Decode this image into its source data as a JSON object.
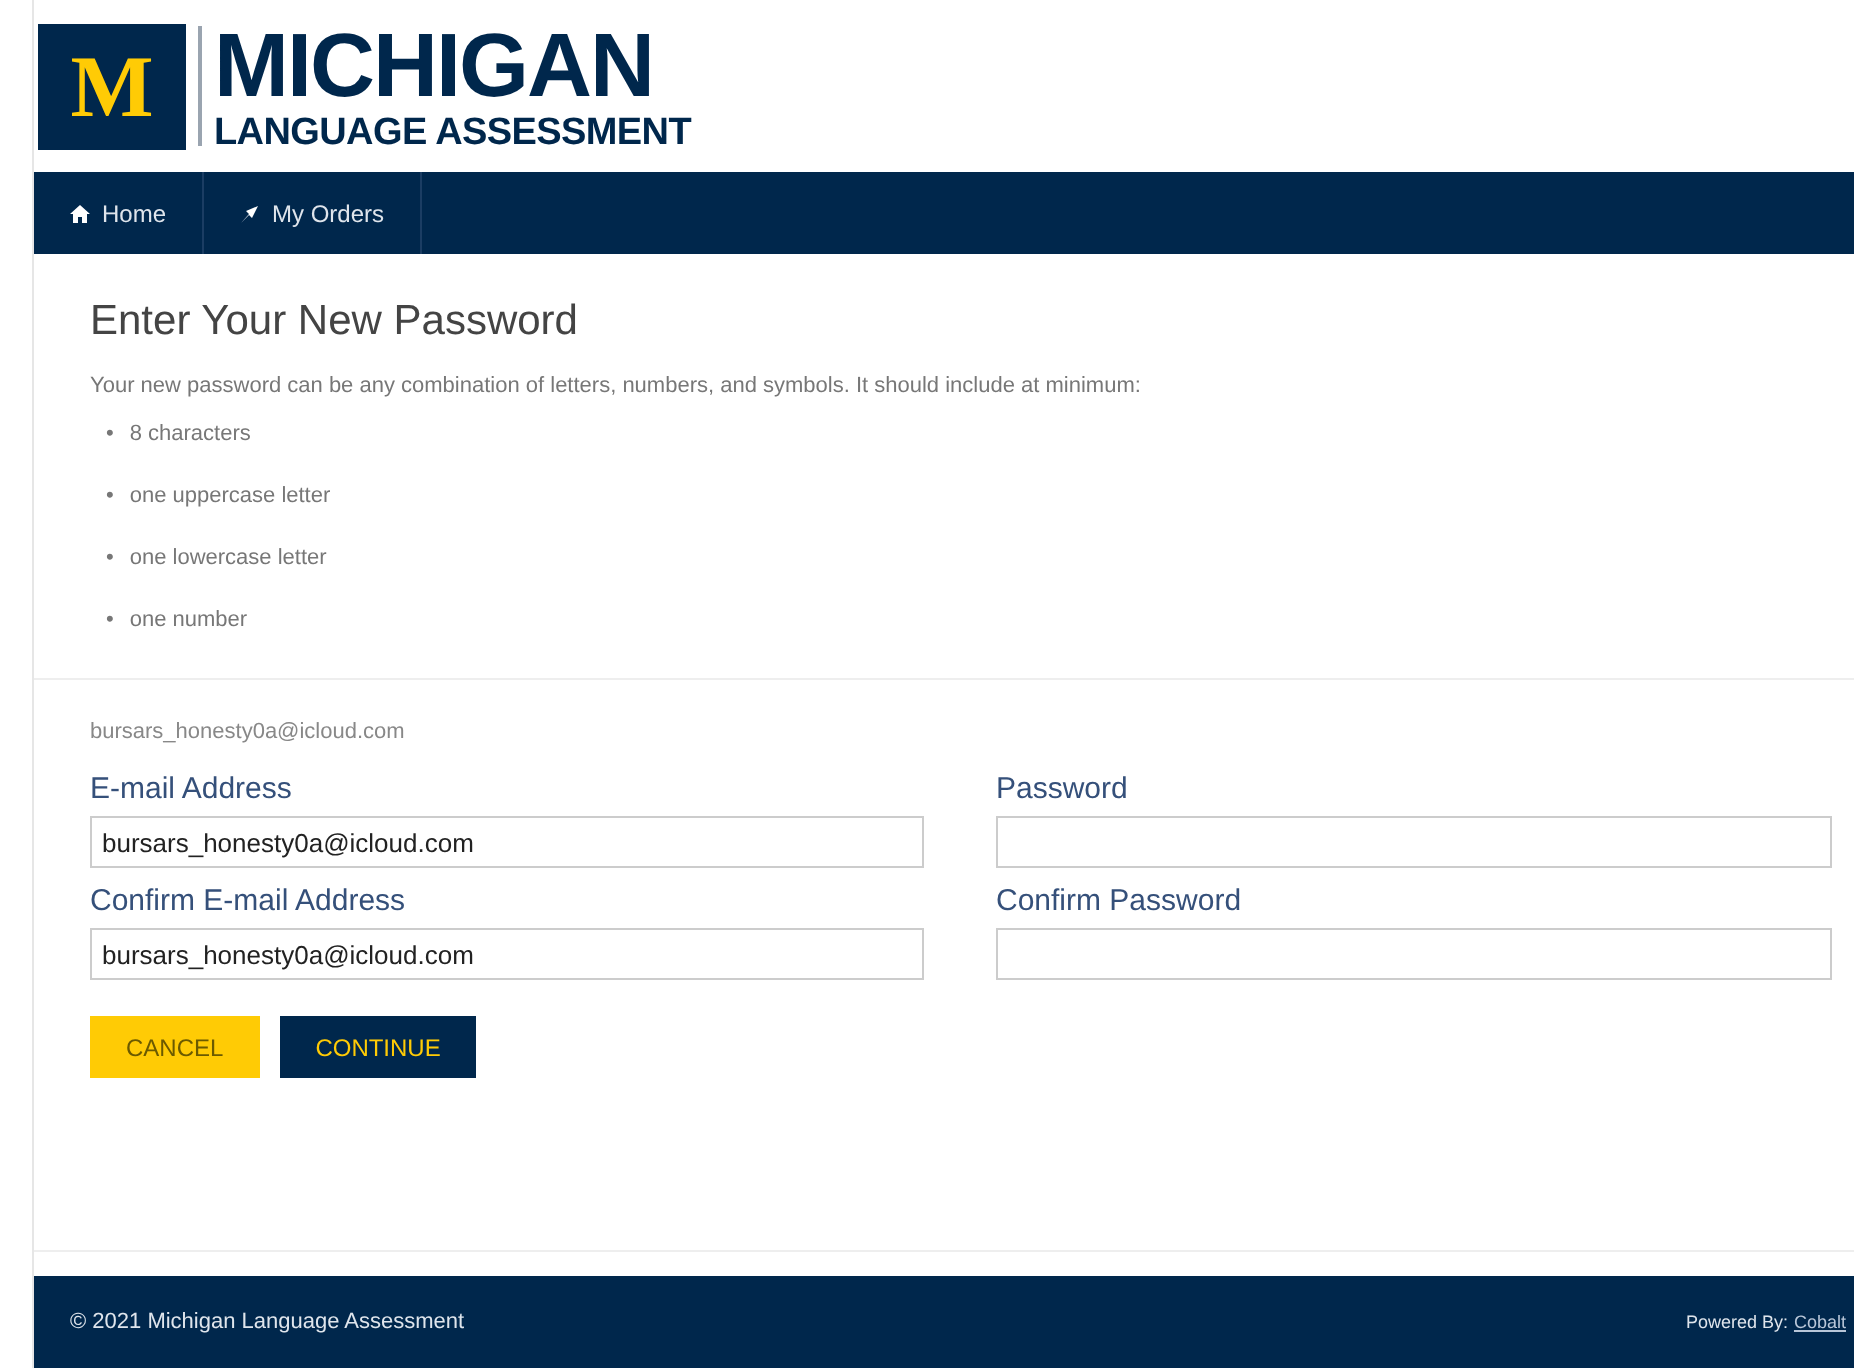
{
  "logo": {
    "mark": "M",
    "title": "MICHIGAN",
    "subtitle": "LANGUAGE ASSESSMENT"
  },
  "nav": [
    {
      "label": "Home"
    },
    {
      "label": "My Orders"
    }
  ],
  "heading": "Enter Your New Password",
  "intro": "Your new password can be any combination of letters, numbers, and symbols. It should include at minimum:",
  "requirements": [
    {
      "bullet": "•",
      "text": "8 characters"
    },
    {
      "bullet": "•",
      "text": "one uppercase letter"
    },
    {
      "bullet": "•",
      "text": "one lowercase letter"
    },
    {
      "bullet": "•",
      "text": "one number"
    }
  ],
  "account_email": "bursars_honesty0a@icloud.com",
  "fields": [
    {
      "label": "E-mail Address",
      "value": "bursars_honesty0a@icloud.com"
    },
    {
      "label": "Password"
    },
    {
      "label": "Confirm E-mail Address",
      "value": "bursars_honesty0a@icloud.com"
    },
    {
      "label": "Confirm Password"
    }
  ],
  "buttons": [
    {
      "label": "CANCEL",
      "kind": "secondary"
    },
    {
      "label": "CONTINUE",
      "kind": "primary"
    }
  ],
  "footer": {
    "copyright": "© 2021 Michigan Language Assessment",
    "powered_by": "Powered By:",
    "link": "Cobalt"
  }
}
